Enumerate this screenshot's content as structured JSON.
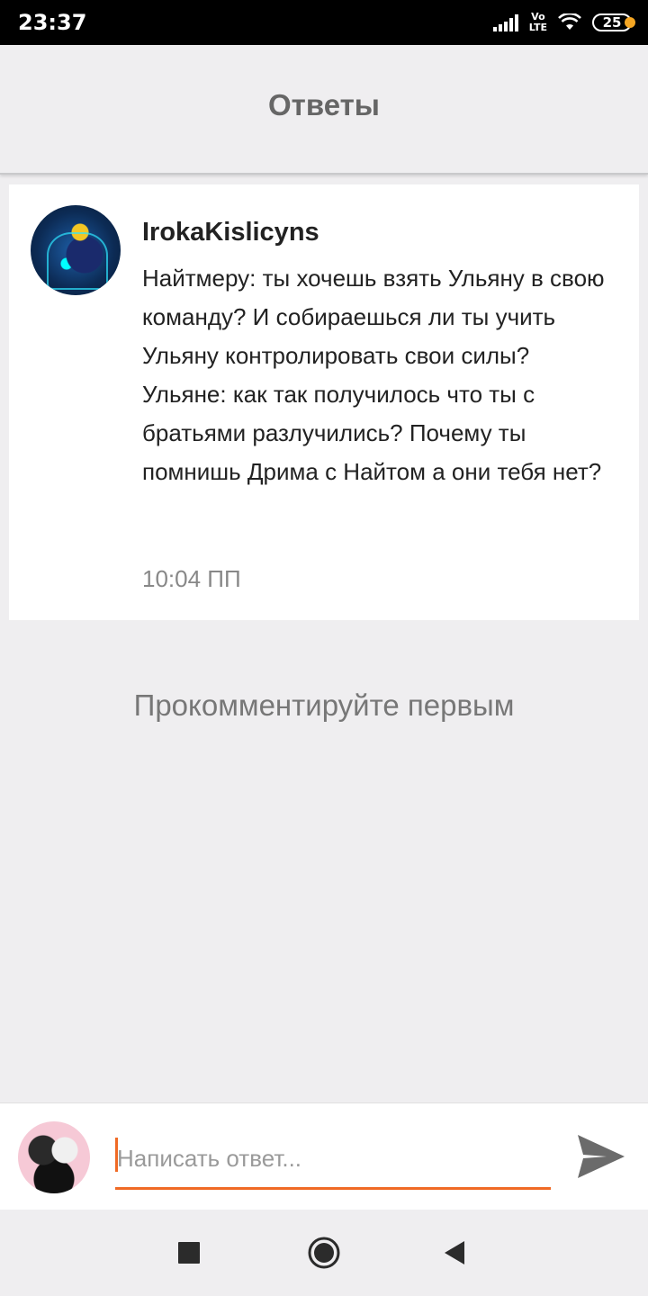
{
  "status_bar": {
    "time": "23:37",
    "network": "LTE",
    "volte": "Vo",
    "battery": "25"
  },
  "header": {
    "title": "Ответы"
  },
  "comment": {
    "username": "IrokaKislicyns",
    "text": "Найтмеру: ты хочешь взять Ульяну в свою команду? И собираешься ли ты учить Ульяну контролировать свои силы?\nУльяне: как так получилось что ты с братьями разлучились? Почему ты помнишь Дрима с Найтом а они тебя нет?",
    "time": "10:04 ПП"
  },
  "empty_state": {
    "text": "Прокомментируйте первым"
  },
  "reply": {
    "placeholder": "Написать ответ...",
    "value": ""
  },
  "colors": {
    "accent": "#f06a25",
    "background": "#efeef0",
    "card": "#ffffff"
  }
}
